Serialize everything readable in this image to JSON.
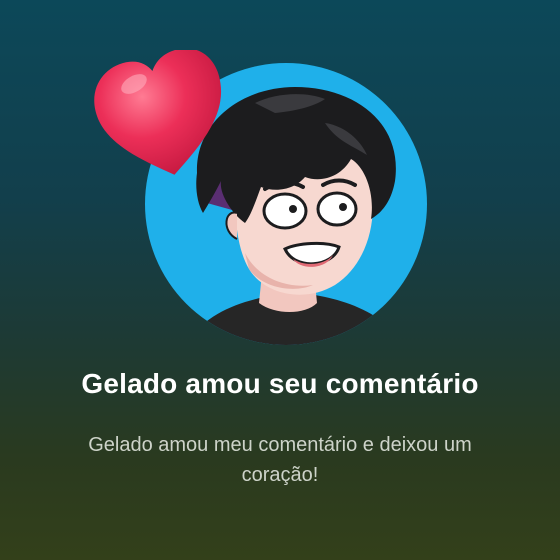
{
  "notification": {
    "title": "Gelado amou seu comentário",
    "message": "Gelado amou meu comentário e deixou um coração!",
    "icon": "heart-icon",
    "avatar": "user-avatar-cartoon"
  },
  "colors": {
    "avatar_background": "#1fb0ea",
    "heart": "#e8264e",
    "title": "#ffffff",
    "message": "#cdd3c9"
  }
}
